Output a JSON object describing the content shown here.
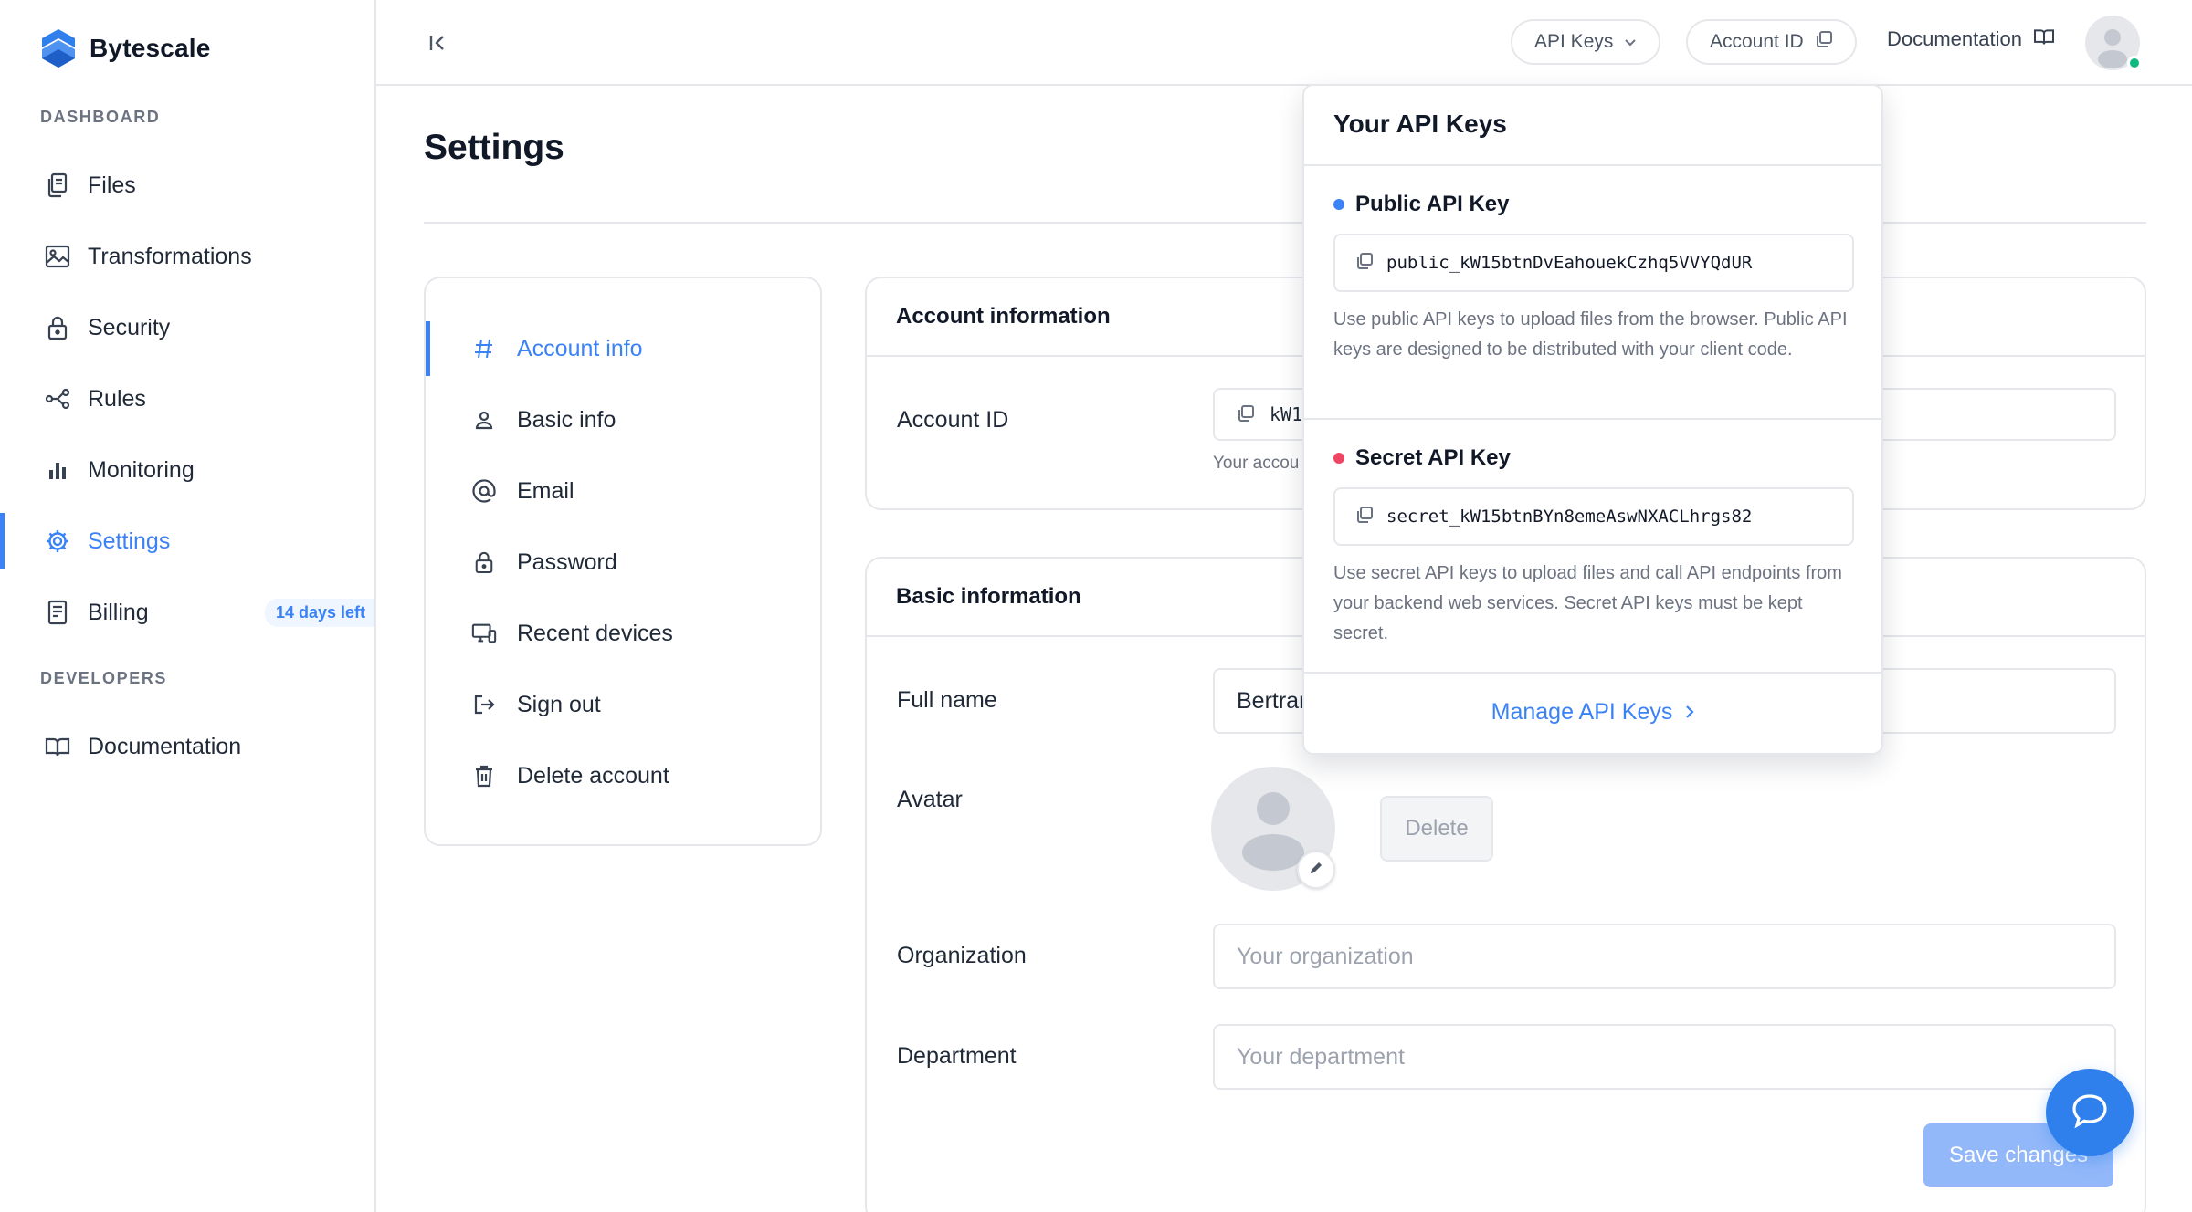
{
  "app": {
    "name": "Bytescale"
  },
  "sidebar": {
    "dashboard_label": "DASHBOARD",
    "developers_label": "DEVELOPERS",
    "items": [
      {
        "label": "Files",
        "icon": "files-icon"
      },
      {
        "label": "Transformations",
        "icon": "image-icon"
      },
      {
        "label": "Security",
        "icon": "lock-icon"
      },
      {
        "label": "Rules",
        "icon": "rules-icon"
      },
      {
        "label": "Monitoring",
        "icon": "bar-chart-icon"
      },
      {
        "label": "Settings",
        "icon": "gear-icon",
        "active": true
      },
      {
        "label": "Billing",
        "icon": "receipt-icon",
        "badge": "14 days left"
      }
    ],
    "dev_items": [
      {
        "label": "Documentation",
        "icon": "book-icon"
      }
    ]
  },
  "topbar": {
    "api_keys_label": "API Keys",
    "account_id_label": "Account ID",
    "documentation_label": "Documentation"
  },
  "page": {
    "title": "Settings"
  },
  "submenu": {
    "items": [
      {
        "label": "Account info",
        "icon": "hash-icon",
        "active": true
      },
      {
        "label": "Basic info",
        "icon": "user-icon"
      },
      {
        "label": "Email",
        "icon": "at-icon"
      },
      {
        "label": "Password",
        "icon": "lock-icon"
      },
      {
        "label": "Recent devices",
        "icon": "devices-icon"
      },
      {
        "label": "Sign out",
        "icon": "sign-out-icon"
      },
      {
        "label": "Delete account",
        "icon": "trash-icon"
      }
    ]
  },
  "account_info": {
    "title": "Account information",
    "account_id_label": "Account ID",
    "account_id_value": "kW1",
    "account_id_help": "Your accou"
  },
  "basic_info": {
    "title": "Basic information",
    "full_name_label": "Full name",
    "full_name_value": "Bertrar",
    "avatar_label": "Avatar",
    "delete_label": "Delete",
    "organization_label": "Organization",
    "organization_placeholder": "Your organization",
    "department_label": "Department",
    "department_placeholder": "Your department",
    "save_label": "Save changes"
  },
  "api_dropdown": {
    "title": "Your API Keys",
    "public": {
      "name": "Public API Key",
      "value": "public_kW15btnDvEahouekCzhq5VVYQdUR",
      "description": "Use public API keys to upload files from the browser. Public API keys are designed to be distributed with your client code.",
      "color": "#3b82f6"
    },
    "secret": {
      "name": "Secret API Key",
      "value": "secret_kW15btnBYn8emeAswNXACLhrgs82",
      "description": "Use secret API keys to upload files and call API endpoints from your backend web services. Secret API keys must be kept secret.",
      "color": "#ef4462"
    },
    "manage_label": "Manage API Keys"
  },
  "colors": {
    "accent": "#3b82f6",
    "online": "#10b981"
  }
}
